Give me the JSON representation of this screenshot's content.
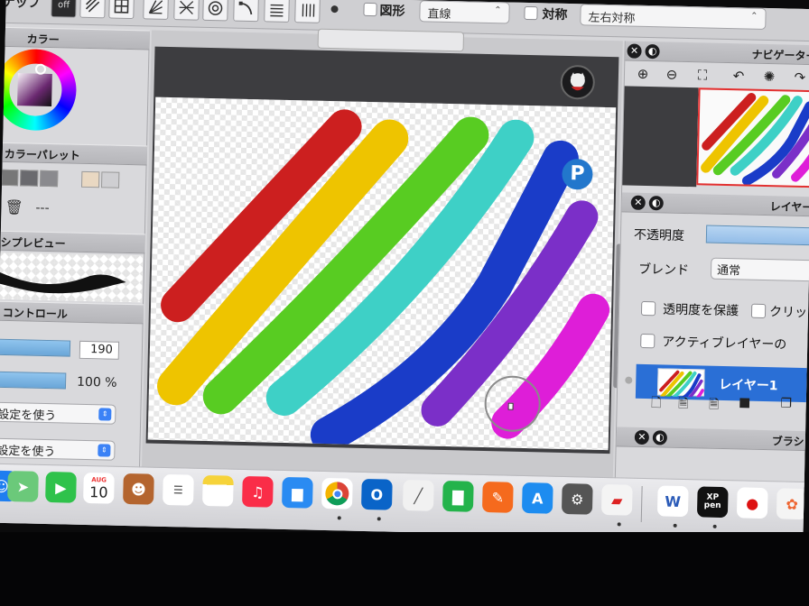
{
  "toolbar": {
    "snap_label": "ナップ",
    "snap_off": "off",
    "shape_label": "図形",
    "shape_value": "直線",
    "symmetry_label": "対称",
    "symmetry_value": "左右対称"
  },
  "left": {
    "color_title": "カラー",
    "palette_title": "カラーパレット",
    "palette_empty": "---",
    "brush_preview_title": "シプレビュー",
    "control_title": "コントロール",
    "size_value": "190",
    "opacity_value": "100 %",
    "setting_1": "設定を使う",
    "setting_2": "設定を使う"
  },
  "right": {
    "navigator_title": "ナビゲーター",
    "layer_title": "レイヤー",
    "opacity_label": "不透明度",
    "blend_label": "ブレンド",
    "blend_value": "通常",
    "protect_label": "透明度を保護",
    "clip_label": "クリッ",
    "active_label": "アクティブレイヤーの",
    "layer_name": "レイヤー1",
    "brush_title": "ブラシ"
  },
  "canvas": {
    "badge_letter": "P",
    "strokes": [
      "#cc1f1f",
      "#eec400",
      "#58cc22",
      "#3ed0c6",
      "#1a3cc8",
      "#7b2fc8",
      "#de1ed8"
    ]
  },
  "dock": {
    "calendar_month": "AUG",
    "calendar_day": "10",
    "xp_label": "XP\npen",
    "word_label": "W"
  }
}
